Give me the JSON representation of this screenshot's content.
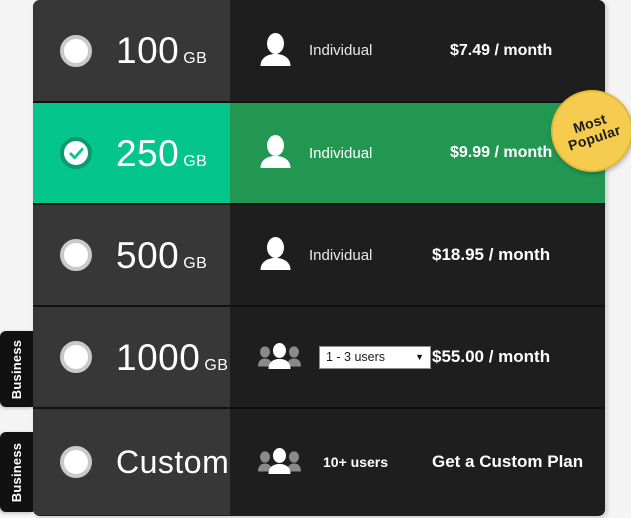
{
  "theme": {
    "page_background": "#f4f4f4",
    "row_dark": "#1e1e1e",
    "row_left_dark": "#373737",
    "selected_left": "#04c58c",
    "selected_right": "#229751",
    "badge_color": "#f5cc4d",
    "tab_color": "#111111"
  },
  "badge": {
    "line1": "Most",
    "line2": "Popular"
  },
  "side_tabs": [
    {
      "label": "Business"
    },
    {
      "label": "Business"
    }
  ],
  "plans": [
    {
      "storage_amount": "100",
      "storage_unit": "GB",
      "selected": "false",
      "user_icon": "single-user-icon",
      "user_type": "Individual",
      "price": "$7.49 / month",
      "has_select": "false"
    },
    {
      "storage_amount": "250",
      "storage_unit": "GB",
      "selected": "true",
      "user_icon": "single-user-icon",
      "user_type": "Individual",
      "price": "$9.99 / month",
      "has_select": "false"
    },
    {
      "storage_amount": "500",
      "storage_unit": "GB",
      "selected": "false",
      "user_icon": "single-user-icon",
      "user_type": "Individual",
      "price": "$18.95 / month",
      "has_select": "false"
    },
    {
      "storage_amount": "1000",
      "storage_unit": "GB",
      "selected": "false",
      "user_icon": "group-users-icon",
      "user_type": "",
      "price": "$55.00 / month",
      "has_select": "true",
      "select_value": "1 - 3 users",
      "select_caret": "▼"
    },
    {
      "storage_amount": "Custom",
      "storage_unit": "",
      "selected": "false",
      "user_icon": "group-users-icon",
      "user_type": "10+ users",
      "price": "Get a Custom Plan",
      "has_select": "false"
    }
  ]
}
